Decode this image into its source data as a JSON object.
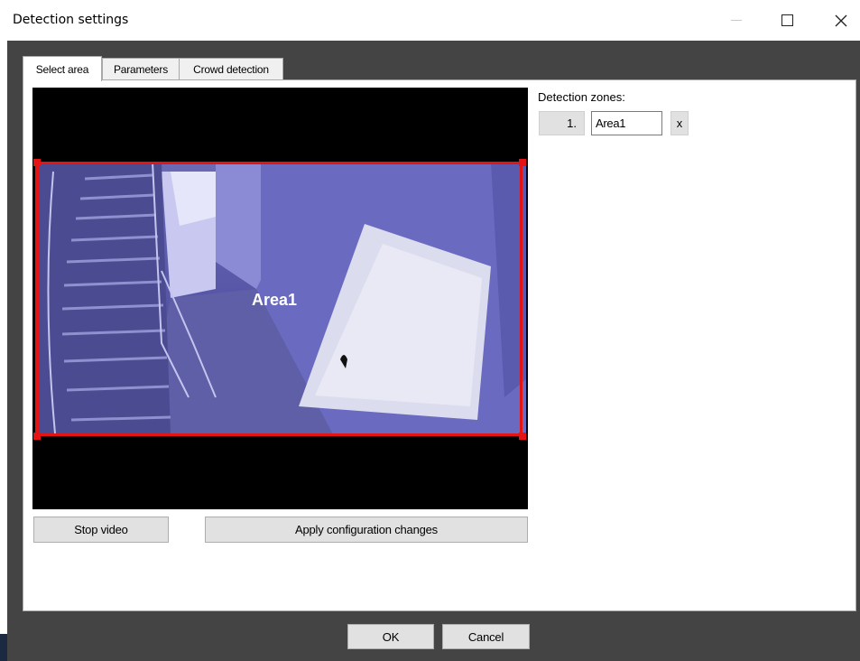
{
  "window": {
    "title": "Detection settings"
  },
  "tabs": [
    {
      "label": "Select area",
      "active": true
    },
    {
      "label": "Parameters",
      "active": false
    },
    {
      "label": "Crowd detection",
      "active": false
    }
  ],
  "video": {
    "zone_overlay_label": "Area1",
    "zone_color": "#e51414"
  },
  "buttons": {
    "stop_video": "Stop video",
    "apply_changes": "Apply configuration changes",
    "ok": "OK",
    "cancel": "Cancel"
  },
  "zones": {
    "label": "Detection zones:",
    "items": [
      {
        "number": "1.",
        "name": "Area1",
        "delete_label": "x"
      }
    ]
  }
}
